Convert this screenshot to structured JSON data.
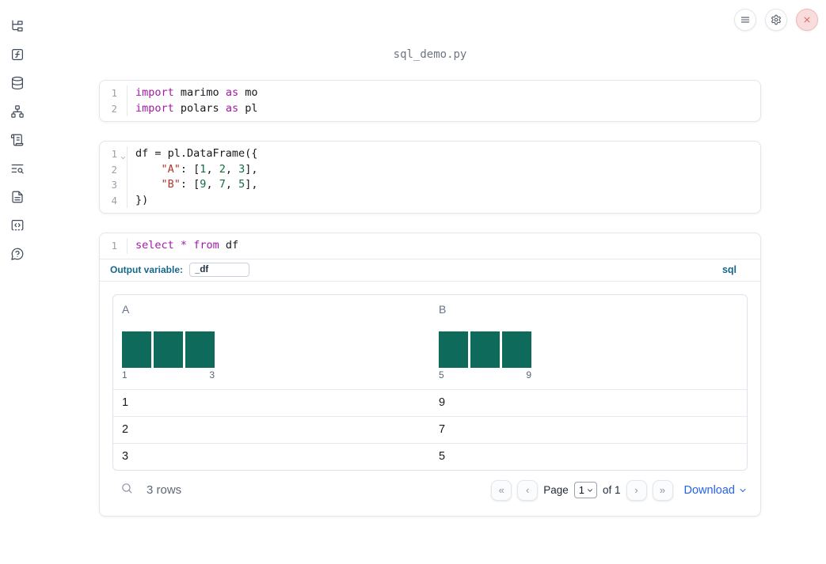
{
  "title": "sql_demo.py",
  "sidebar": {
    "icons": [
      "file-tree",
      "function",
      "database",
      "dependency-graph",
      "logs",
      "snippets",
      "documentation",
      "scratchpad",
      "help"
    ]
  },
  "topbar": {
    "controls": [
      "menu",
      "settings",
      "shutdown"
    ]
  },
  "cells": {
    "imports": {
      "lines": [
        {
          "num": "1",
          "t": [
            "import",
            " marimo ",
            "as",
            " mo"
          ]
        },
        {
          "num": "2",
          "t": [
            "import",
            " polars ",
            "as",
            " pl"
          ]
        }
      ]
    },
    "dataframe": {
      "lines": [
        {
          "num": "1",
          "t": [
            "df = pl.DataFrame({"
          ]
        },
        {
          "num": "2",
          "t": [
            "    ",
            "\"A\"",
            ": [",
            "1",
            ", ",
            "2",
            ", ",
            "3",
            "],"
          ]
        },
        {
          "num": "3",
          "t": [
            "    ",
            "\"B\"",
            ": [",
            "9",
            ", ",
            "7",
            ", ",
            "5",
            "],"
          ]
        },
        {
          "num": "4",
          "t": [
            "})"
          ]
        }
      ]
    },
    "sql": {
      "lines": [
        {
          "num": "1",
          "t": [
            "select",
            " ",
            "*",
            " ",
            "from",
            " df"
          ]
        }
      ],
      "output_variable_label": "Output variable:",
      "output_variable_value": "_df",
      "language_badge": "sql"
    }
  },
  "table": {
    "columns": [
      {
        "name": "A",
        "hist_values": [
          1,
          2,
          3
        ],
        "hist_bar_count": 3,
        "hist_min": "1",
        "hist_max": "3"
      },
      {
        "name": "B",
        "hist_values": [
          9,
          7,
          5
        ],
        "hist_bar_count": 3,
        "hist_min": "5",
        "hist_max": "9"
      }
    ],
    "rows": [
      [
        "1",
        "9"
      ],
      [
        "2",
        "7"
      ],
      [
        "3",
        "5"
      ]
    ],
    "row_count": "3 rows",
    "pagination": {
      "first": "«",
      "prev": "‹",
      "page_label": "Page",
      "page_value": "1",
      "of_label": "of 1",
      "next": "›",
      "last": "»"
    },
    "download": "Download"
  },
  "colors": {
    "histogram_bar": "#0e6b5c",
    "keyword": "#a01ba5",
    "string": "#b0352b",
    "number": "#116d3f",
    "label_blue": "#15688c",
    "download_blue": "#2563eb",
    "close_button_bg": "#f9dcdc"
  }
}
